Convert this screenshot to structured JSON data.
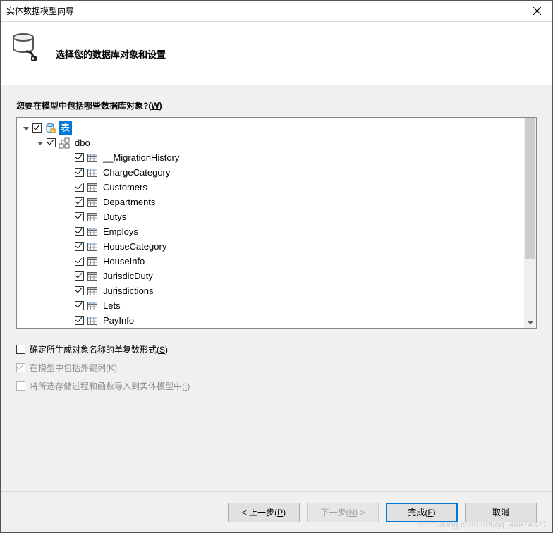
{
  "window": {
    "title": "实体数据模型向导"
  },
  "header": {
    "heading": "选择您的数据库对象和设置"
  },
  "section": {
    "label_pre": "您要在模型中包括哪些数据库对象?(",
    "label_accel": "W",
    "label_post": ")"
  },
  "tree": {
    "root": {
      "label": "表",
      "checked": true,
      "expanded": true,
      "selected": true
    },
    "schema": {
      "label": "dbo",
      "checked": true,
      "expanded": true
    },
    "tables": [
      {
        "label": "__MigrationHistory",
        "checked": true
      },
      {
        "label": "ChargeCategory",
        "checked": true
      },
      {
        "label": "Customers",
        "checked": true
      },
      {
        "label": "Departments",
        "checked": true
      },
      {
        "label": "Dutys",
        "checked": true
      },
      {
        "label": "Employs",
        "checked": true
      },
      {
        "label": "HouseCategory",
        "checked": true
      },
      {
        "label": "HouseInfo",
        "checked": true
      },
      {
        "label": "JurisdicDuty",
        "checked": true
      },
      {
        "label": "Jurisdictions",
        "checked": true
      },
      {
        "label": "Lets",
        "checked": true
      },
      {
        "label": "PayInfo",
        "checked": true
      }
    ]
  },
  "options": [
    {
      "label_pre": "确定所生成对象名称的单复数形式(",
      "label_accel": "S",
      "label_post": ")",
      "checked": false,
      "enabled": true
    },
    {
      "label_pre": "在模型中包括外键列(",
      "label_accel": "K",
      "label_post": ")",
      "checked": true,
      "enabled": false
    },
    {
      "label_pre": "将所选存储过程和函数导入到实体模型中(",
      "label_accel": "I",
      "label_post": ")",
      "checked": false,
      "enabled": false
    }
  ],
  "buttons": {
    "back": {
      "prefix": "< 上一步(",
      "accel": "P",
      "suffix": ")"
    },
    "next": {
      "prefix": "下一步(",
      "accel": "N",
      "suffix": ") >"
    },
    "finish": {
      "prefix": "完成(",
      "accel": "F",
      "suffix": ")"
    },
    "cancel": {
      "label": "取消"
    }
  },
  "watermark": "https://blog.csdn.net/qq_46874327"
}
